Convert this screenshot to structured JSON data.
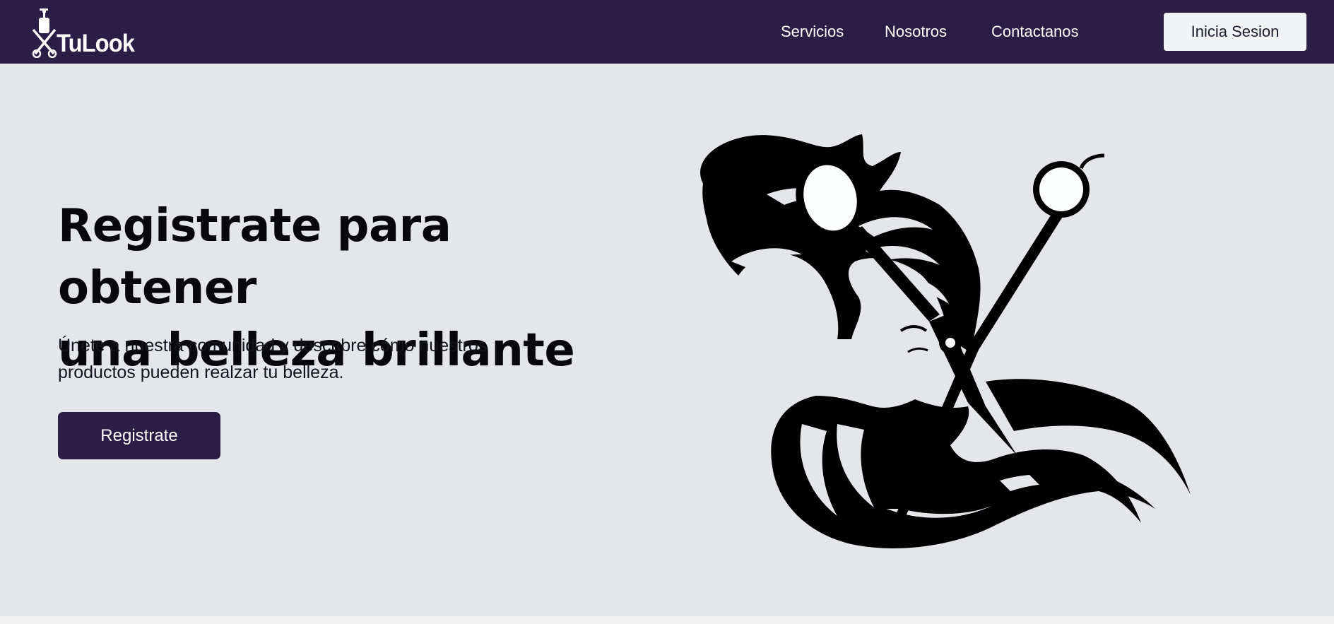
{
  "header": {
    "logo": {
      "brand_text": "TuLook",
      "icon": "scissors-bottle-icon"
    },
    "nav": [
      {
        "label": "Servicios"
      },
      {
        "label": "Nosotros"
      },
      {
        "label": "Contactanos"
      }
    ],
    "login_label": "Inicia Sesion"
  },
  "hero": {
    "title_line1": "Registrate para obtener",
    "title_line2": "una belleza brillante",
    "subtitle_line1": "Únete a nuestra comunidad y descubre cómo nuestros",
    "subtitle_line2": "productos pueden realzar tu belleza.",
    "cta_label": "Registrate",
    "illustration": "woman-hair-scissors-illustration"
  },
  "colors": {
    "nav_background": "#2b1e46",
    "page_background": "#e5e6ea",
    "button_primary": "#2b1e46",
    "button_light": "#f2f3f5",
    "text_dark": "#08080a"
  }
}
